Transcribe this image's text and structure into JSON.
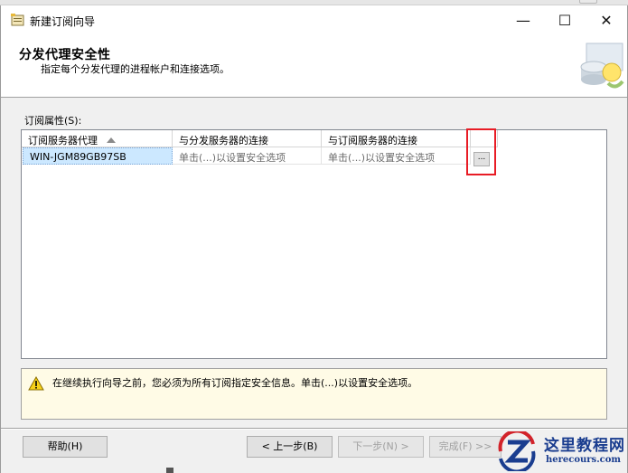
{
  "window": {
    "title": "新建订阅向导",
    "minimize_symbol": "—",
    "maximize_symbol": "☐",
    "close_symbol": "✕"
  },
  "header": {
    "title": "分发代理安全性",
    "subtitle": "指定每个分发代理的进程帐户和连接选项。"
  },
  "grid": {
    "label": "订阅属性(S):",
    "columns": [
      "订阅服务器代理",
      "与分发服务器的连接",
      "与订阅服务器的连接"
    ],
    "rows": [
      [
        "WIN-JGM89GB97SB",
        "单击(...)以设置安全选项",
        "单击(...)以设置安全选项"
      ]
    ],
    "ellipsis_label": "...",
    "sort": "ascending"
  },
  "warning": {
    "text": "在继续执行向导之前，您必须为所有订阅指定安全信息。单击(...)以设置安全选项。"
  },
  "buttons": {
    "help": "帮助(H)",
    "back": "< 上一步(B)",
    "next": "下一步(N) >",
    "finish": "完成(F) >>"
  },
  "watermark": {
    "title": "这里教程网",
    "url": "herecours.com"
  },
  "colors": {
    "highlight_border": "#e81c25",
    "selection": "#cce8ff",
    "warning_bg": "#fffbe6",
    "watermark": "#1a3d8f"
  }
}
